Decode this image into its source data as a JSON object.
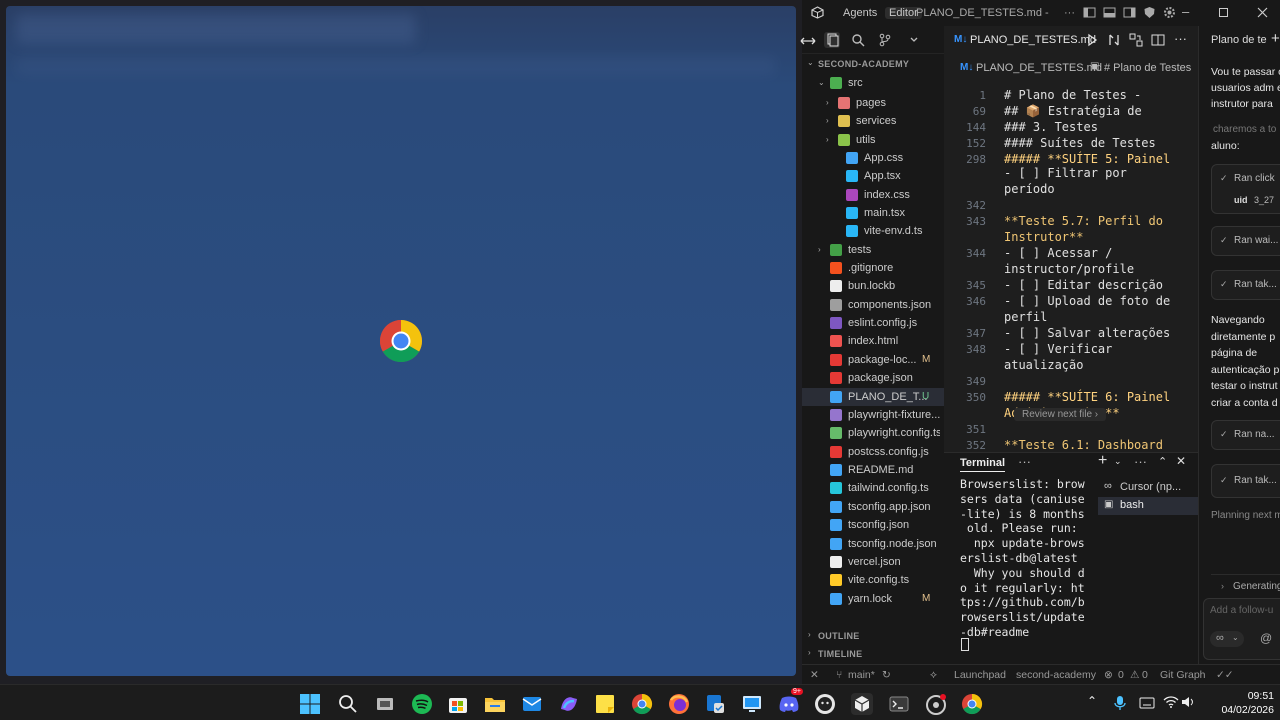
{
  "titlebar": {
    "agents_label": "Agents",
    "editor_label": "Editor",
    "window_title": "PLANO_DE_TESTES.md - secon...",
    "accent": "#3794ff"
  },
  "explorer": {
    "header": "SECOND-ACADEMY",
    "outline": "OUTLINE",
    "timeline": "TIMELINE",
    "items": [
      {
        "label": "src",
        "status": ""
      },
      {
        "label": "pages",
        "status": ""
      },
      {
        "label": "services",
        "status": ""
      },
      {
        "label": "utils",
        "status": ""
      },
      {
        "label": "App.css",
        "status": ""
      },
      {
        "label": "App.tsx",
        "status": ""
      },
      {
        "label": "index.css",
        "status": ""
      },
      {
        "label": "main.tsx",
        "status": ""
      },
      {
        "label": "vite-env.d.ts",
        "status": ""
      },
      {
        "label": "tests",
        "status": ""
      },
      {
        "label": ".gitignore",
        "status": ""
      },
      {
        "label": "bun.lockb",
        "status": ""
      },
      {
        "label": "components.json",
        "status": ""
      },
      {
        "label": "eslint.config.js",
        "status": ""
      },
      {
        "label": "index.html",
        "status": ""
      },
      {
        "label": "package-loc...",
        "status": "M"
      },
      {
        "label": "package.json",
        "status": ""
      },
      {
        "label": "PLANO_DE_T...",
        "status": "U"
      },
      {
        "label": "playwright-fixture....",
        "status": ""
      },
      {
        "label": "playwright.config.ts",
        "status": ""
      },
      {
        "label": "postcss.config.js",
        "status": ""
      },
      {
        "label": "README.md",
        "status": ""
      },
      {
        "label": "tailwind.config.ts",
        "status": ""
      },
      {
        "label": "tsconfig.app.json",
        "status": ""
      },
      {
        "label": "tsconfig.json",
        "status": ""
      },
      {
        "label": "tsconfig.node.json",
        "status": ""
      },
      {
        "label": "vercel.json",
        "status": ""
      },
      {
        "label": "vite.config.ts",
        "status": ""
      },
      {
        "label": "yarn.lock",
        "status": "M"
      }
    ]
  },
  "editor": {
    "tab_label": "PLANO_DE_TESTES.md",
    "breadcrumb_file": "PLANO_DE_TESTES.md",
    "breadcrumb_section": "# Plano de Testes",
    "review_label": "Review next file",
    "lines": [
      {
        "n": "1",
        "text": "# Plano de Testes -"
      },
      {
        "n": "69",
        "text": "## 📦 Estratégia de"
      },
      {
        "n": "144",
        "text": "### 3. Testes"
      },
      {
        "n": "152",
        "text": "#### Suítes de Testes"
      },
      {
        "n": "298",
        "text": "##### **SUÍTE 5: Painel"
      },
      {
        "n": "",
        "text": "- [ ] Filtrar por"
      },
      {
        "n": "",
        "text": "período"
      },
      {
        "n": "342",
        "text": ""
      },
      {
        "n": "343",
        "text": "**Teste 5.7: Perfil do"
      },
      {
        "n": "",
        "text": "Instrutor**"
      },
      {
        "n": "344",
        "text": "- [ ] Acessar /"
      },
      {
        "n": "",
        "text": "instructor/profile"
      },
      {
        "n": "345",
        "text": "- [ ] Editar descrição"
      },
      {
        "n": "346",
        "text": "- [ ] Upload de foto de"
      },
      {
        "n": "",
        "text": "perfil"
      },
      {
        "n": "347",
        "text": "- [ ] Salvar alterações"
      },
      {
        "n": "348",
        "text": "- [ ] Verificar"
      },
      {
        "n": "",
        "text": "atualização"
      },
      {
        "n": "349",
        "text": ""
      },
      {
        "n": "350",
        "text": "##### **SUÍTE 6: Painel"
      },
      {
        "n": "",
        "text": "Administrativo**"
      },
      {
        "n": "351",
        "text": ""
      },
      {
        "n": "352",
        "text": "**Teste 6.1: Dashboard"
      },
      {
        "n": "",
        "text": "Admin**"
      }
    ]
  },
  "terminal": {
    "tab_label": "Terminal",
    "text": "Browserslist: brow\nsers data (caniuse\n-lite) is 8 months\n old. Please run:\n  npx update-brows\nerslist-db@latest\n  Why you should d\no it regularly: ht\ntps://github.com/b\nrowserslist/update\n-db#readme",
    "sessions": [
      "Cursor (np...",
      "bash"
    ]
  },
  "chat": {
    "title": "Plano de te",
    "intro": "Vou te passar o\nusuarios adm e\ninstrutor para",
    "faded": "charemos a to",
    "aluno": "aluno:",
    "ran_click": "Ran click",
    "uid": "uid",
    "uid_value": "3_27",
    "ran_1": "Ran wai...",
    "ran_2": "Ran tak...",
    "nav": "Navegando\ndiretamente p\npágina de\nautenticação p\ntestar o instrut\ncriar a conta d",
    "ran_3": "Ran na...",
    "ran_4": "Ran tak...",
    "planning": "Planning next m",
    "generating": "Generating",
    "followup_placeholder": "Add a follow-u",
    "mode": "∞"
  },
  "statusbar": {
    "branch": "main*",
    "launchpad": "Launchpad",
    "workspace": "second-academy",
    "errors": "0",
    "warnings": "0",
    "gitgraph": "Git Graph"
  },
  "taskbar": {
    "time": "09:51",
    "date": "04/02/2026",
    "discord_badge": "9+"
  }
}
